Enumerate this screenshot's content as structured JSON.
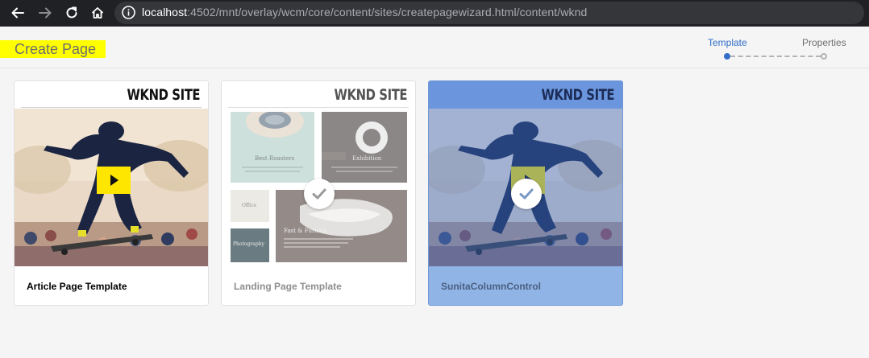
{
  "browser": {
    "url_host": "localhost",
    "url_path": ":4502/mnt/overlay/wcm/core/content/sites/createpagewizard.html/content/wknd",
    "icons": [
      "back-icon",
      "forward-icon",
      "reload-icon",
      "home-icon",
      "info-icon"
    ]
  },
  "header": {
    "title": "Create Page",
    "steps": [
      {
        "label": "Template",
        "state": "active"
      },
      {
        "label": "Properties",
        "state": "pending"
      }
    ]
  },
  "templates": [
    {
      "label": "Article Page Template",
      "brand": "WKND SITE",
      "state": "normal"
    },
    {
      "label": "Landing Page Template",
      "brand": "WKND SITE",
      "state": "disabled",
      "tiles": {
        "roasters_title": "Best Roasters",
        "exhibition_title": "Exhibition",
        "office_title": "Office",
        "photography_title": "Photography",
        "fast_title": "Fast & Furious"
      }
    },
    {
      "label": "SunitaColumnControl",
      "brand": "WKND SITE",
      "state": "selected"
    }
  ],
  "colors": {
    "accent": "#326ec8",
    "highlight": "#ffff00",
    "selected_card": "#91b4e6",
    "video_play": "#ffe600"
  }
}
